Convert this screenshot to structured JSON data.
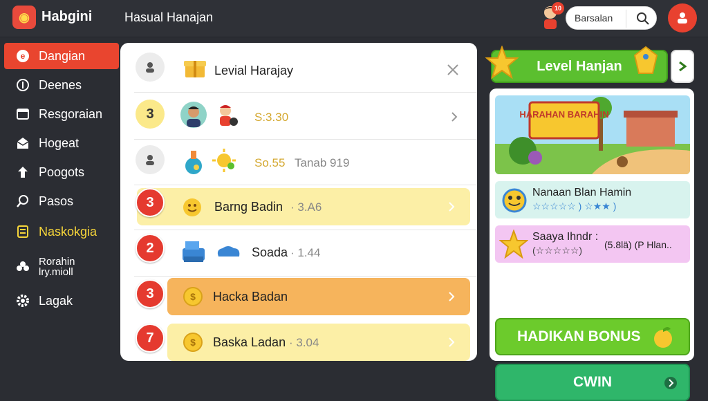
{
  "app": {
    "title": "Habgini",
    "breadcrumb": "Hasual Hanajan"
  },
  "header": {
    "search_text": "Barsalan",
    "avatar_badge": "10"
  },
  "sidebar": {
    "items": [
      {
        "label": "Dangian"
      },
      {
        "label": "Deenes"
      },
      {
        "label": "Resgoraian"
      },
      {
        "label": "Hogeat"
      },
      {
        "label": "Poogots"
      },
      {
        "label": "Pasos"
      },
      {
        "label": "Naskokgia"
      },
      {
        "label": "Rorahin lry.mioll"
      },
      {
        "label": "Lagak"
      }
    ]
  },
  "list": {
    "rows": [
      {
        "rank": "",
        "title": "Levial Harajay",
        "value": ""
      },
      {
        "rank": "3",
        "title": "",
        "value": "S:3.30"
      },
      {
        "rank": "",
        "title": "So.55",
        "value": "Tanab 919"
      },
      {
        "rank": "3",
        "title": "Barng Badin",
        "value": "· 3.A6"
      },
      {
        "rank": "2",
        "title": "Soada",
        "value": "· 1.44"
      },
      {
        "rank": "3",
        "title": "Hacka Badan",
        "value": ""
      },
      {
        "rank": "7",
        "title": "Baska Ladan",
        "value": "· 3.04"
      }
    ]
  },
  "right": {
    "level_button": "Level Hanjan",
    "banner_text": "HARAHAN BARAHIN",
    "card1": {
      "title": "Nanaan Blan Hamin",
      "stars": "☆☆☆☆☆ ) ☆★★ )"
    },
    "card2": {
      "title": "Saaya Ihndr :",
      "value": "(5.8lä) (P Hlan..",
      "stars": "(☆☆☆☆☆)"
    },
    "bonus_button": "HADIKAN BONUS",
    "cwin_button": "CWIN"
  },
  "colors": {
    "accent_red": "#e9452f",
    "green": "#5bbf2f",
    "yellow_pill": "#fcefa6",
    "orange_pill": "#f6b45c"
  }
}
